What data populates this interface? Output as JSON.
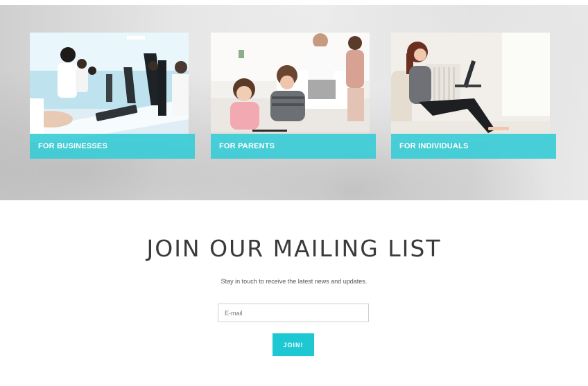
{
  "cards": [
    {
      "label": "FOR BUSINESSES"
    },
    {
      "label": "FOR PARENTS"
    },
    {
      "label": "FOR INDIVIDUALS"
    }
  ],
  "mailing": {
    "title": "JOIN OUR MAILING LIST",
    "subtitle": "Stay in touch to receive the latest news and updates.",
    "email_placeholder": "E-mail",
    "email_value": "",
    "submit_label": "JOIN!"
  },
  "colors": {
    "accent": "#1ec8d3",
    "label_bar": "#3accd6"
  }
}
